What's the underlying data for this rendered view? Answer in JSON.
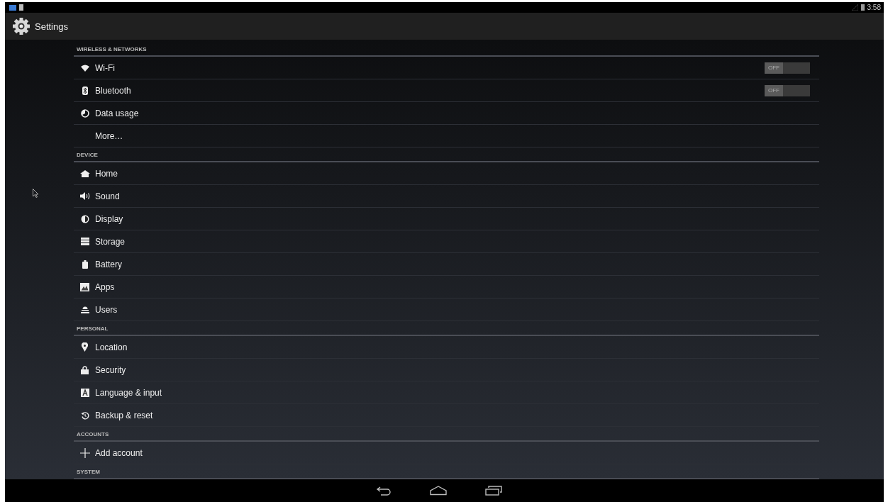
{
  "status_bar": {
    "time": "3:58"
  },
  "action_bar": {
    "title": "Settings"
  },
  "sections": [
    {
      "title": "WIRELESS & NETWORKS",
      "items": [
        {
          "label": "Wi-Fi",
          "toggle": {
            "label": "OFF",
            "on": false
          }
        },
        {
          "label": "Bluetooth",
          "toggle": {
            "label": "OFF",
            "on": false
          }
        },
        {
          "label": "Data usage"
        },
        {
          "label": "More…"
        }
      ]
    },
    {
      "title": "DEVICE",
      "items": [
        {
          "label": "Home"
        },
        {
          "label": "Sound"
        },
        {
          "label": "Display"
        },
        {
          "label": "Storage"
        },
        {
          "label": "Battery"
        },
        {
          "label": "Apps"
        },
        {
          "label": "Users"
        }
      ]
    },
    {
      "title": "PERSONAL",
      "items": [
        {
          "label": "Location"
        },
        {
          "label": "Security"
        },
        {
          "label": "Language & input"
        },
        {
          "label": "Backup & reset"
        }
      ]
    },
    {
      "title": "ACCOUNTS",
      "items": [
        {
          "label": "Add account"
        }
      ]
    },
    {
      "title": "SYSTEM"
    }
  ]
}
